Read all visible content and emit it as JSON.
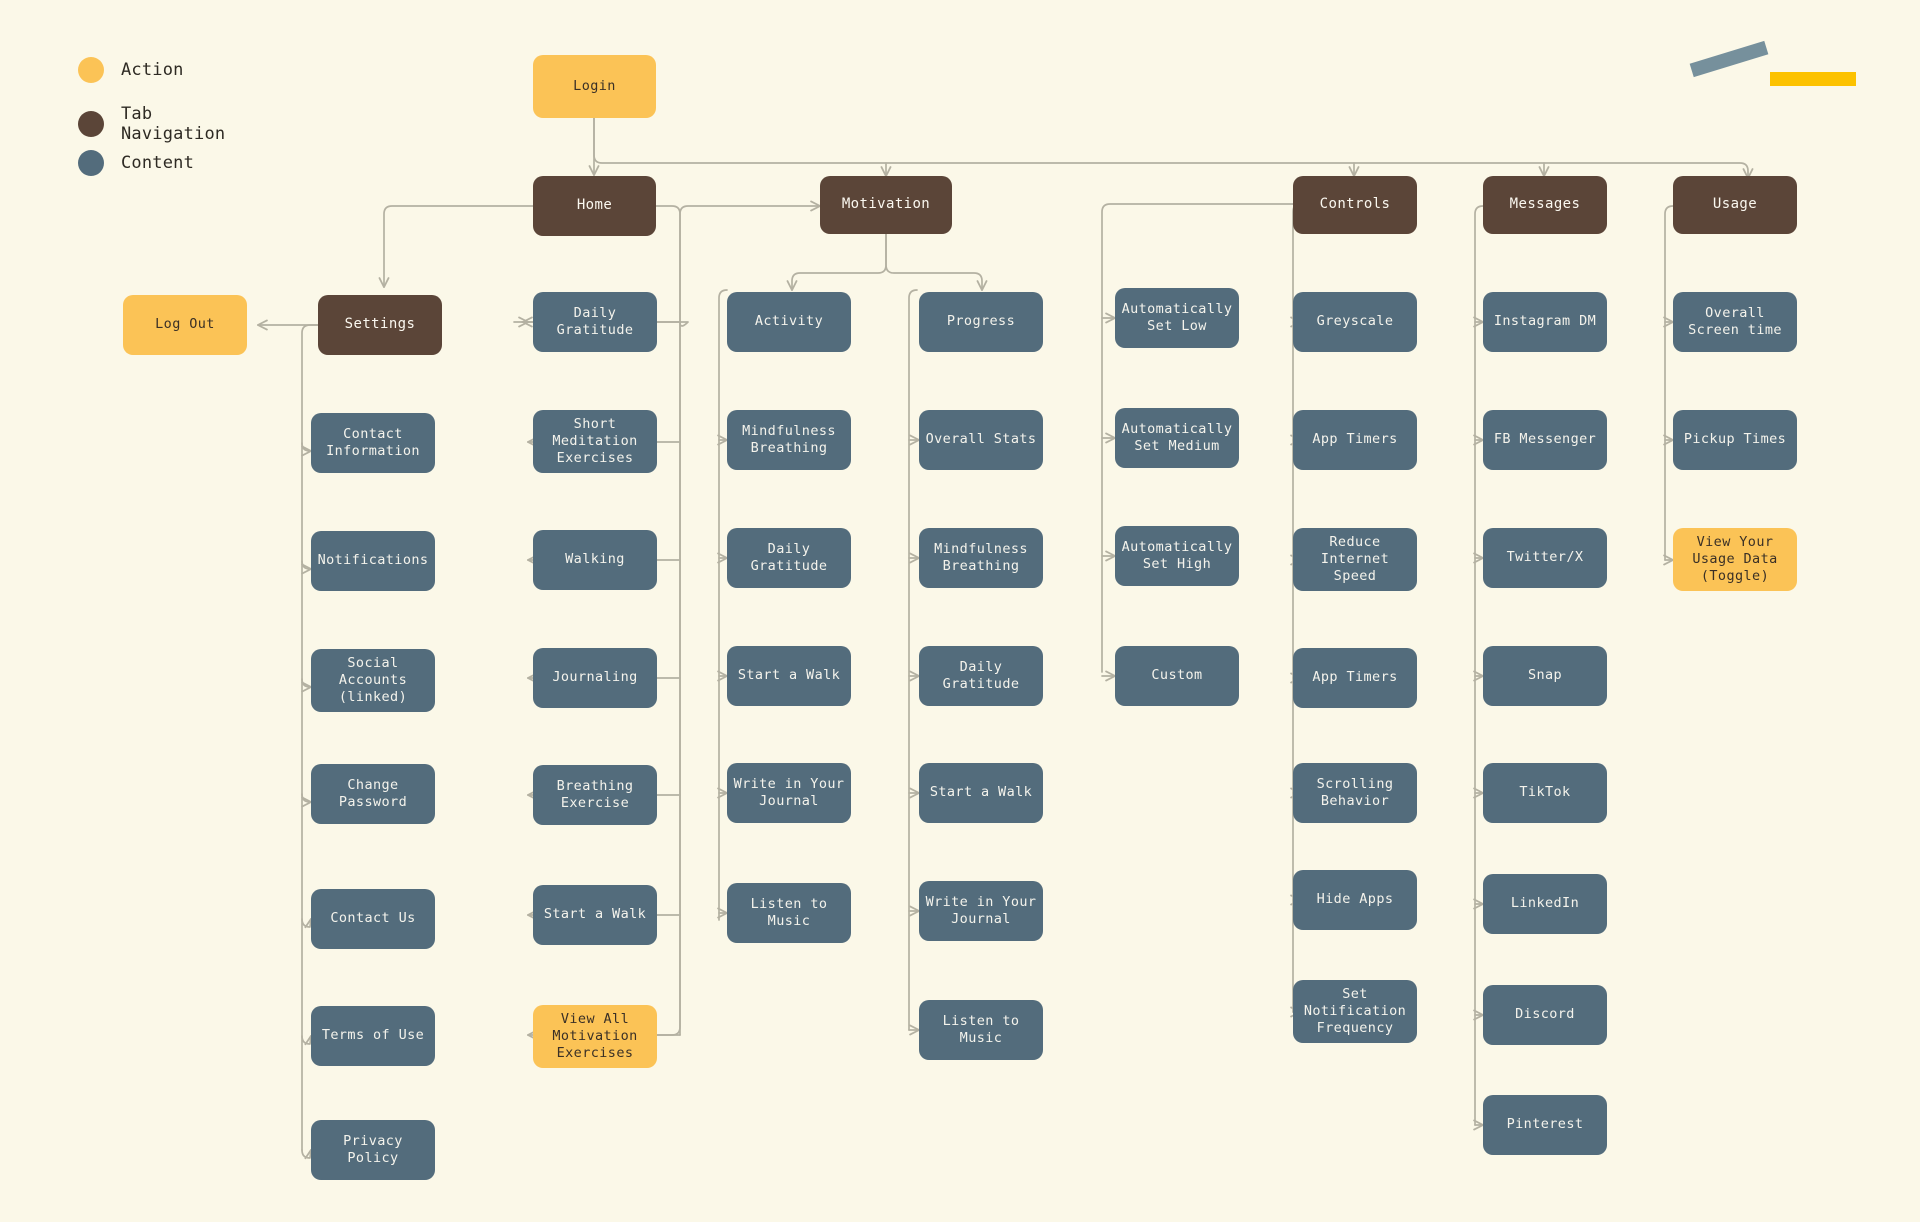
{
  "meta": {
    "diagram_type": "sitemap-flowchart",
    "background_color": "#FBF8E8",
    "connector_color": "#B4B1A2"
  },
  "legend": {
    "items": [
      {
        "label": "Action",
        "color": "#FBC356",
        "key": "action"
      },
      {
        "label": "Tab Navigation",
        "color": "#5B4538",
        "key": "tab"
      },
      {
        "label": "Content",
        "color": "#536C7C",
        "key": "content"
      }
    ]
  },
  "decorations": {
    "slash": {
      "color": "#76909C"
    },
    "bar": {
      "color": "#FCC200"
    }
  },
  "nodes": {
    "login": {
      "label": "Login",
      "type": "action"
    },
    "home": {
      "label": "Home",
      "type": "tab"
    },
    "motivation": {
      "label": "Motivation",
      "type": "tab"
    },
    "controls": {
      "label": "Controls",
      "type": "tab"
    },
    "messages": {
      "label": "Messages",
      "type": "tab"
    },
    "usage": {
      "label": "Usage",
      "type": "tab"
    },
    "settings": {
      "label": "Settings",
      "type": "tab"
    },
    "logout": {
      "label": "Log Out",
      "type": "action"
    },
    "activity": {
      "label": "Activity",
      "type": "content"
    },
    "progress": {
      "label": "Progress",
      "type": "content"
    }
  },
  "columns": {
    "settings": {
      "parent": "Settings",
      "items": [
        {
          "label": "Contact\nInformation",
          "type": "content"
        },
        {
          "label": "Notifications",
          "type": "content"
        },
        {
          "label": "Social\nAccounts\n(linked)",
          "type": "content"
        },
        {
          "label": "Change\nPassword",
          "type": "content"
        },
        {
          "label": "Contact Us",
          "type": "content"
        },
        {
          "label": "Terms of Use",
          "type": "content"
        },
        {
          "label": "Privacy\nPolicy",
          "type": "content"
        }
      ]
    },
    "home": {
      "parent": "Home",
      "items": [
        {
          "label": "Daily\nGratitude",
          "type": "content"
        },
        {
          "label": "Short\nMeditation\nExercises",
          "type": "content"
        },
        {
          "label": "Walking",
          "type": "content"
        },
        {
          "label": "Journaling",
          "type": "content"
        },
        {
          "label": "Breathing\nExercise",
          "type": "content"
        },
        {
          "label": "Start a Walk",
          "type": "content"
        },
        {
          "label": "View All\nMotivation\nExercises",
          "type": "action"
        }
      ]
    },
    "activity": {
      "parent": "Activity",
      "items": [
        {
          "label": "Mindfulness\nBreathing",
          "type": "content"
        },
        {
          "label": "Daily\nGratitude",
          "type": "content"
        },
        {
          "label": "Start a Walk",
          "type": "content"
        },
        {
          "label": "Write in Your\nJournal",
          "type": "content"
        },
        {
          "label": "Listen to\nMusic",
          "type": "content"
        }
      ]
    },
    "progress": {
      "parent": "Progress",
      "items": [
        {
          "label": "Overall Stats",
          "type": "content"
        },
        {
          "label": "Mindfulness\nBreathing",
          "type": "content"
        },
        {
          "label": "Daily\nGratitude",
          "type": "content"
        },
        {
          "label": "Start a Walk",
          "type": "content"
        },
        {
          "label": "Write in Your\nJournal",
          "type": "content"
        },
        {
          "label": "Listen to\nMusic",
          "type": "content"
        }
      ]
    },
    "autoset": {
      "parent": "Controls",
      "items": [
        {
          "label": "Automatically\nSet Low",
          "type": "content"
        },
        {
          "label": "Automatically\nSet Medium",
          "type": "content"
        },
        {
          "label": "Automatically\nSet High",
          "type": "content"
        },
        {
          "label": "Custom",
          "type": "content"
        }
      ]
    },
    "controls": {
      "parent": "Controls",
      "items": [
        {
          "label": "Greyscale",
          "type": "content"
        },
        {
          "label": "App Timers",
          "type": "content"
        },
        {
          "label": "Reduce\nInternet\nSpeed",
          "type": "content"
        },
        {
          "label": "App Timers",
          "type": "content"
        },
        {
          "label": "Scrolling\nBehavior",
          "type": "content"
        },
        {
          "label": "Hide Apps",
          "type": "content"
        },
        {
          "label": "Set\nNotification\nFrequency",
          "type": "content"
        }
      ]
    },
    "messages": {
      "parent": "Messages",
      "items": [
        {
          "label": "Instagram DM",
          "type": "content"
        },
        {
          "label": "FB Messenger",
          "type": "content"
        },
        {
          "label": "Twitter/X",
          "type": "content"
        },
        {
          "label": "Snap",
          "type": "content"
        },
        {
          "label": "TikTok",
          "type": "content"
        },
        {
          "label": "LinkedIn",
          "type": "content"
        },
        {
          "label": "Discord",
          "type": "content"
        },
        {
          "label": "Pinterest",
          "type": "content"
        }
      ]
    },
    "usage": {
      "parent": "Usage",
      "items": [
        {
          "label": "Overall\nScreen time",
          "type": "content"
        },
        {
          "label": "Pickup Times",
          "type": "content"
        },
        {
          "label": "View Your\nUsage Data\n(Toggle)",
          "type": "action"
        }
      ]
    }
  }
}
